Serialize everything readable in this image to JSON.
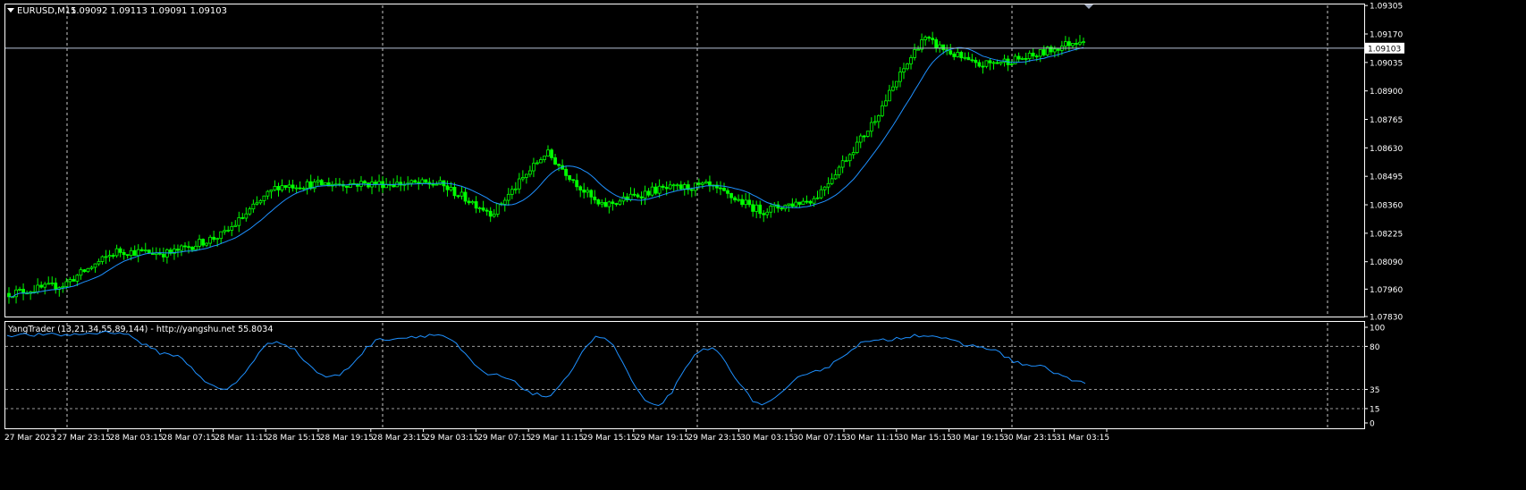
{
  "header": {
    "title": "EURUSD,M15",
    "ohlc": "1.09092 1.09113 1.09091 1.09103",
    "dropdown_icon": "triangle-down-icon"
  },
  "indicator": {
    "label": "YangTrader (13,21,34,55,89,144) - http://yangshu.net 55.8034",
    "ticks": [
      "100",
      "80",
      "35",
      "15",
      "0"
    ],
    "tick_values": [
      100,
      80,
      35,
      15,
      0
    ],
    "line_color": "#1e90ff"
  },
  "price_axis": {
    "ticks": [
      "1.09305",
      "1.09170",
      "1.09035",
      "1.08900",
      "1.08765",
      "1.08630",
      "1.08495",
      "1.08360",
      "1.08225",
      "1.08090",
      "1.07960",
      "1.07830"
    ],
    "current_price": "1.09103"
  },
  "time_axis": {
    "labels": [
      "27 Mar 2023",
      "27 Mar 23:15",
      "28 Mar 03:15",
      "28 Mar 07:15",
      "28 Mar 11:15",
      "28 Mar 15:15",
      "28 Mar 19:15",
      "28 Mar 23:15",
      "29 Mar 03:15",
      "29 Mar 07:15",
      "29 Mar 11:15",
      "29 Mar 15:15",
      "29 Mar 19:15",
      "29 Mar 23:15",
      "30 Mar 03:15",
      "30 Mar 07:15",
      "30 Mar 11:15",
      "30 Mar 15:15",
      "30 Mar 19:15",
      "30 Mar 23:15",
      "31 Mar 03:15"
    ]
  },
  "colors": {
    "background": "#000000",
    "candle": "#00ff00",
    "ma_line": "#1e90ff",
    "grid": "#c8c8c8",
    "axis_text": "#ffffff"
  },
  "chart_data": {
    "type": "line",
    "symbol": "EURUSD",
    "timeframe": "M15",
    "ylim": [
      1.0783,
      1.0931
    ],
    "x": [
      "27 Mar 2023",
      "27 Mar 23:15",
      "28 Mar 03:15",
      "28 Mar 07:15",
      "28 Mar 11:15",
      "28 Mar 15:15",
      "28 Mar 19:15",
      "28 Mar 23:15",
      "29 Mar 03:15",
      "29 Mar 07:15",
      "29 Mar 11:15",
      "29 Mar 15:15",
      "29 Mar 19:15",
      "29 Mar 23:15",
      "30 Mar 03:15",
      "30 Mar 07:15",
      "30 Mar 11:15",
      "30 Mar 15:15",
      "30 Mar 19:15",
      "30 Mar 23:15",
      "31 Mar 03:15"
    ],
    "series": [
      {
        "values": [
          1.0794,
          1.0798,
          1.0814,
          1.0813,
          1.0822,
          1.0845,
          1.0846,
          1.0846,
          1.0846,
          1.0832,
          1.0861,
          1.0835,
          1.0843,
          1.0845,
          1.0833,
          1.0839,
          1.0872,
          1.0915,
          1.0902,
          1.0906,
          1.0915
        ]
      }
    ],
    "indicator_series": [
      {
        "values": [
          92,
          92,
          95,
          72,
          35,
          85,
          48,
          88,
          92,
          50,
          28,
          90,
          18,
          78,
          20,
          55,
          85,
          92,
          80,
          60,
          42
        ]
      }
    ],
    "indicator_ylim": [
      0,
      100
    ],
    "current_price": 1.09103,
    "grid": true
  }
}
